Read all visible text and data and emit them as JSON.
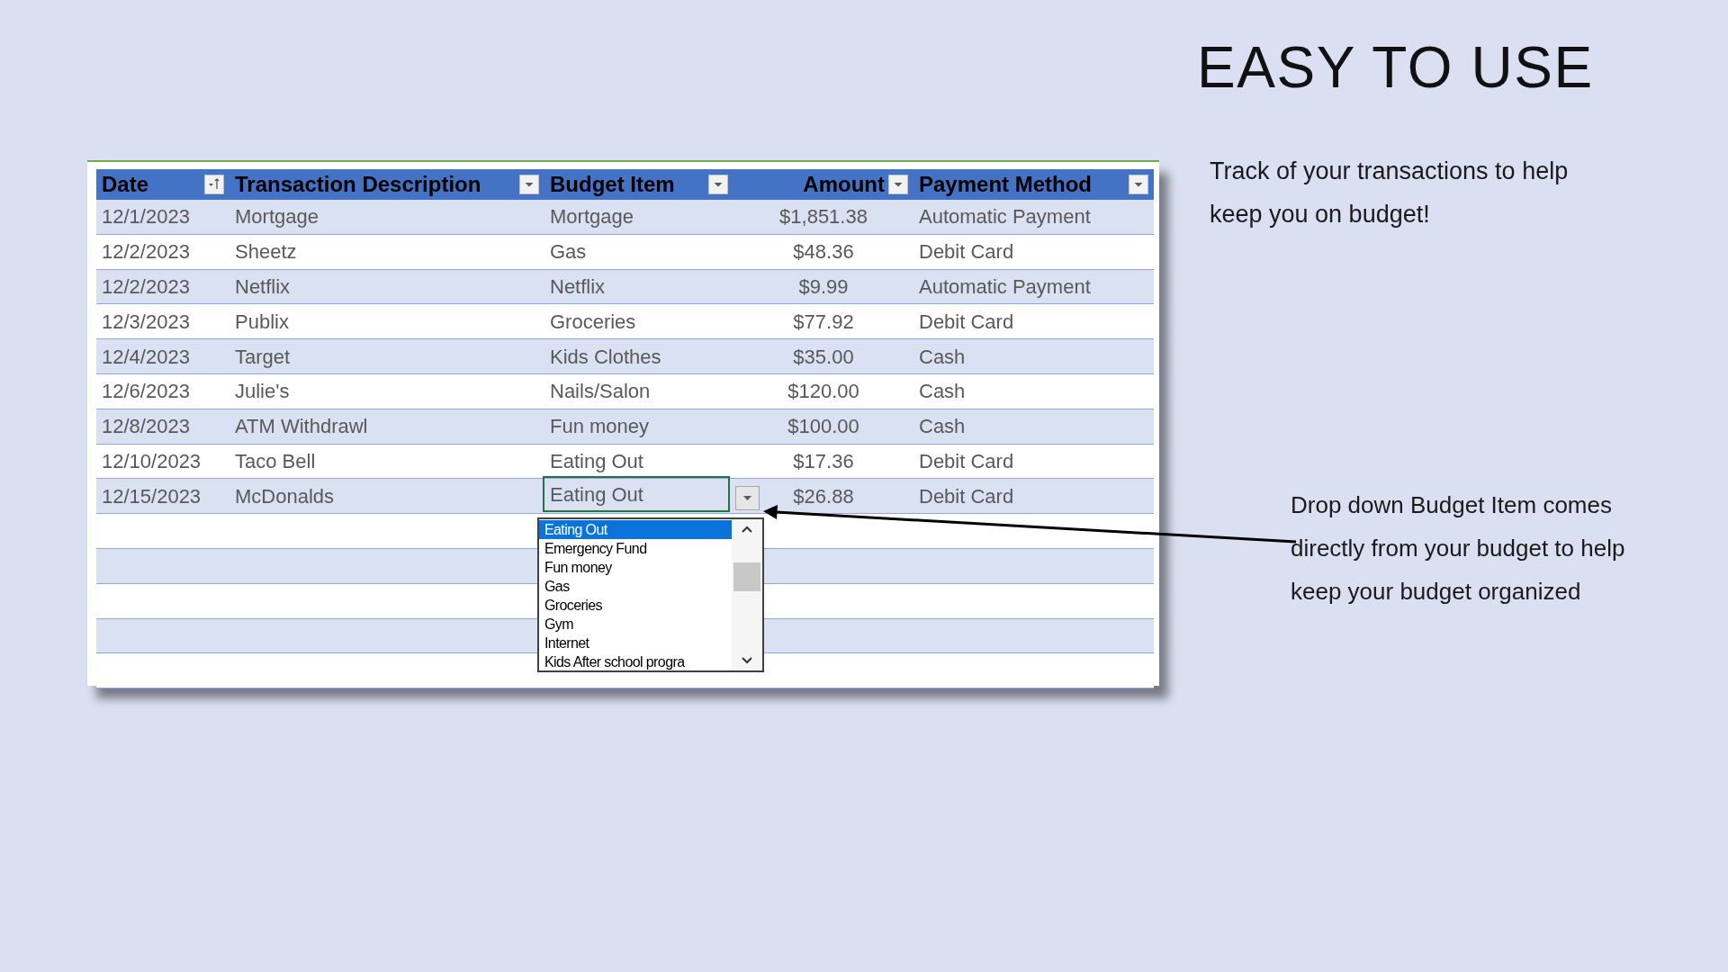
{
  "title": "EASY TO USE",
  "table": {
    "columns": [
      {
        "label": "Date",
        "kind": "sorted"
      },
      {
        "label": "Transaction Description",
        "kind": "filter"
      },
      {
        "label": "Budget Item",
        "kind": "filter"
      },
      {
        "label": "Amount",
        "kind": "filter"
      },
      {
        "label": "Payment Method",
        "kind": "filter"
      }
    ],
    "rows": [
      {
        "cells": [
          "12/1/2023",
          "Mortgage",
          "Mortgage",
          "$1,851.38",
          "Automatic Payment"
        ],
        "selected": false
      },
      {
        "cells": [
          "12/2/2023",
          "Sheetz",
          "Gas",
          "$48.36",
          "Debit Card"
        ],
        "selected": false
      },
      {
        "cells": [
          "12/2/2023",
          "Netflix",
          "Netflix",
          "$9.99",
          "Automatic Payment"
        ],
        "selected": false
      },
      {
        "cells": [
          "12/3/2023",
          "Publix",
          "Groceries",
          "$77.92",
          "Debit Card"
        ],
        "selected": false
      },
      {
        "cells": [
          "12/4/2023",
          "Target",
          "Kids Clothes",
          "$35.00",
          "Cash"
        ],
        "selected": false
      },
      {
        "cells": [
          "12/6/2023",
          "Julie's",
          "Nails/Salon",
          "$120.00",
          "Cash"
        ],
        "selected": false
      },
      {
        "cells": [
          "12/8/2023",
          "ATM Withdrawl",
          "Fun money",
          "$100.00",
          "Cash"
        ],
        "selected": false
      },
      {
        "cells": [
          "12/10/2023",
          "Taco Bell",
          "Eating Out",
          "$17.36",
          "Debit Card"
        ],
        "selected": false
      },
      {
        "cells": [
          "12/15/2023",
          "McDonalds",
          "Eating Out",
          "$26.88",
          "Debit Card"
        ],
        "selected": true
      }
    ],
    "dropdown": {
      "items": [
        {
          "label": "Eating Out",
          "selected": true
        },
        {
          "label": "Emergency Fund",
          "selected": false
        },
        {
          "label": "Fun money",
          "selected": false
        },
        {
          "label": "Gas",
          "selected": false
        },
        {
          "label": "Groceries",
          "selected": false
        },
        {
          "label": "Gym",
          "selected": false
        },
        {
          "label": "Internet",
          "selected": false
        },
        {
          "label": "Kids After school progra",
          "selected": false
        }
      ]
    }
  },
  "notes": [
    "Track of your transactions to help keep you on budget!",
    "Drop down Budget Item comes directly from your budget to help keep your budget organized"
  ]
}
